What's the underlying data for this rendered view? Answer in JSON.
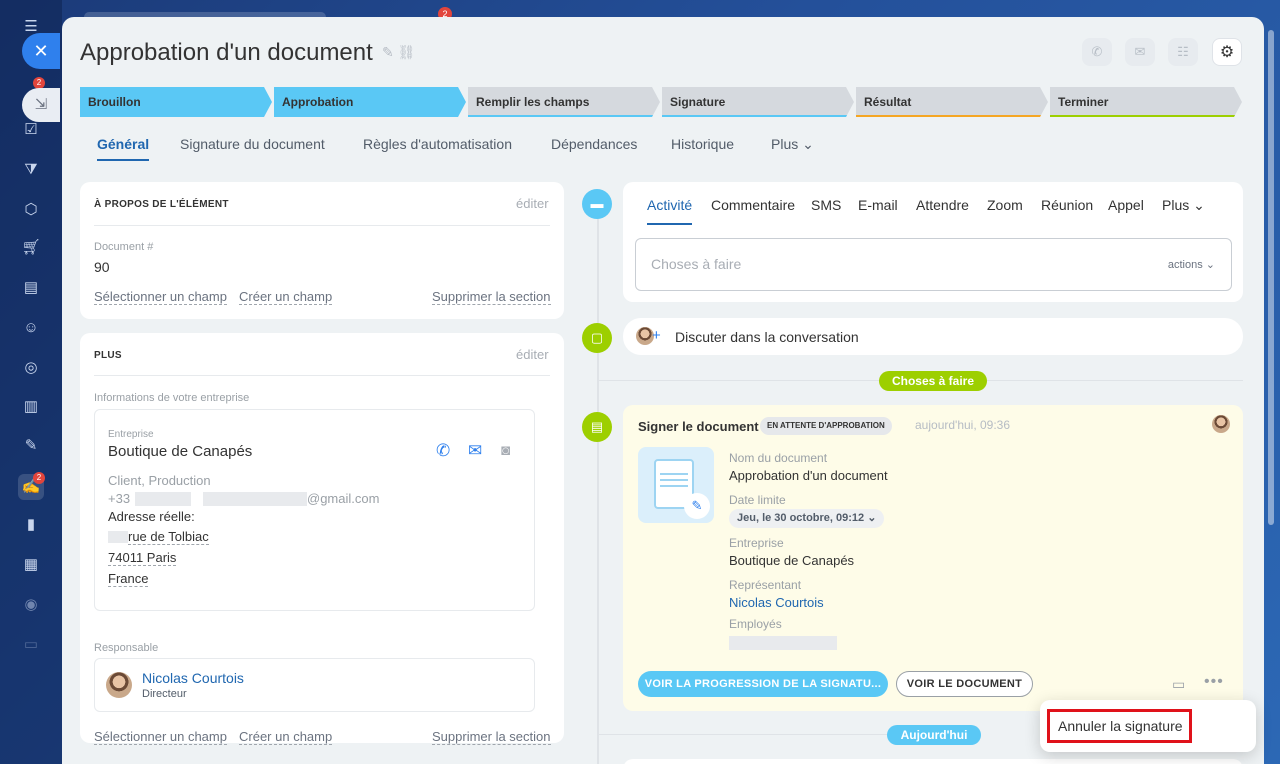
{
  "sidebar": {
    "badge_counts": [
      "2",
      "2"
    ]
  },
  "top_bar": {
    "badge": "2"
  },
  "page": {
    "title": "Approbation d'un document"
  },
  "stages": [
    "Brouillon",
    "Approbation",
    "Remplir les champs",
    "Signature",
    "Résultat",
    "Terminer"
  ],
  "tabs": [
    "Général",
    "Signature du document",
    "Règles d'automatisation",
    "Dépendances",
    "Historique",
    "Plus"
  ],
  "about": {
    "title": "À PROPOS DE L'ÉLÉMENT",
    "edit": "éditer",
    "doc_label": "Document #",
    "doc_value": "90",
    "select_field": "Sélectionner un champ",
    "create_field": "Créer un champ",
    "delete_section": "Supprimer la section"
  },
  "plus_section": {
    "title": "PLUS",
    "edit": "éditer",
    "company_info_label": "Informations de votre entreprise",
    "company_label": "Entreprise",
    "company_name": "Boutique de Canapés",
    "company_type": "Client, Production",
    "phone_prefix": "+33",
    "email_suffix": "@gmail.com",
    "address_label": "Adresse réelle:",
    "street": "rue de Tolbiac",
    "city": "74011 Paris",
    "country": "France",
    "responsible_label": "Responsable",
    "responsible_name": "Nicolas Courtois",
    "responsible_role": "Directeur",
    "select_field": "Sélectionner un champ",
    "create_field": "Créer un champ",
    "delete_section": "Supprimer la section"
  },
  "activity": {
    "tabs": [
      "Activité",
      "Commentaire",
      "SMS",
      "E-mail",
      "Attendre",
      "Zoom",
      "Réunion",
      "Appel",
      "Plus"
    ],
    "todo_placeholder": "Choses à faire",
    "actions_label": "actions"
  },
  "chat": {
    "label": "Discuter dans la conversation"
  },
  "pills": {
    "todo": "Choses à faire",
    "today": "Aujourd'hui"
  },
  "sign_card": {
    "title": "Signer le document",
    "status": "EN ATTENTE D'APPROBATION",
    "time": "aujourd'hui, 09:36",
    "doc_name_label": "Nom du document",
    "doc_name": "Approbation d'un document",
    "deadline_label": "Date limite",
    "deadline": "Jeu, le 30 octobre, 09:12",
    "company_label": "Entreprise",
    "company": "Boutique de Canapés",
    "rep_label": "Représentant",
    "rep": "Nicolas Courtois",
    "employees_label": "Employés",
    "btn_progress": "VOIR LA PROGRESSION DE LA SIGNATU...",
    "btn_view": "VOIR LE DOCUMENT"
  },
  "popup": {
    "cancel_signature": "Annuler la signature"
  },
  "colors": {
    "accent": "#2067b0",
    "stage_active": "#5ac8f5",
    "green": "#9dcf00",
    "highlight": "#e0121a"
  }
}
